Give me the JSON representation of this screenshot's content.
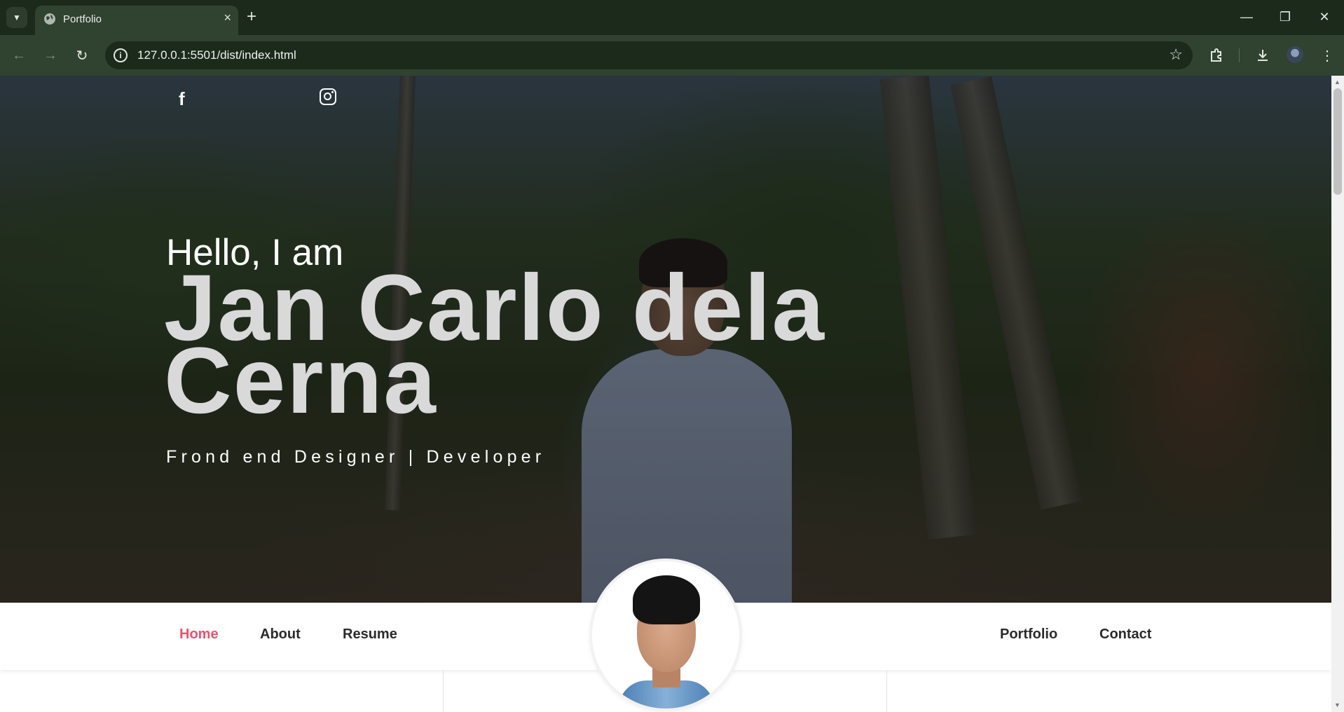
{
  "browser": {
    "tab_title": "Portfolio",
    "url": "127.0.0.1:5501/dist/index.html"
  },
  "icons": {
    "tab_search": "chevron-down-icon",
    "favicon": "globe-icon",
    "tab_close": "close-icon",
    "new_tab": "plus-icon",
    "back": "arrow-left-icon",
    "forward": "arrow-right-icon",
    "reload": "reload-icon",
    "site_info": "info-icon",
    "bookmark": "star-icon",
    "extensions": "puzzle-icon",
    "downloads": "download-icon",
    "menu": "kebab-menu-icon",
    "facebook": "facebook-icon",
    "instagram": "instagram-icon"
  },
  "hero": {
    "greeting": "Hello, I am",
    "name": "Jan Carlo dela Cerna",
    "role": "Frond end Designer | Developer"
  },
  "nav": {
    "left": [
      "Home",
      "About",
      "Resume"
    ],
    "right": [
      "Portfolio",
      "Contact"
    ],
    "active": "Home"
  },
  "colors": {
    "accent": "#f0506e",
    "chrome_dark": "#1c2a1c",
    "chrome": "#304230",
    "nav_text": "#2b2b2b"
  }
}
